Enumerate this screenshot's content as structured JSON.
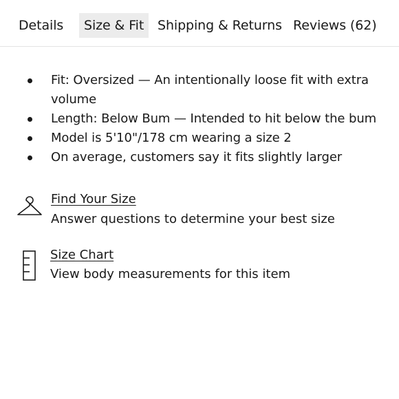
{
  "tabs": [
    {
      "label": "Details",
      "active": false
    },
    {
      "label": "Size & Fit",
      "active": true
    },
    {
      "label": "Shipping & Returns",
      "active": false
    },
    {
      "label": "Reviews (62)",
      "active": false
    }
  ],
  "fit_bullets": [
    "Fit: Oversized — An intentionally loose fit with extra volume",
    "Length: Below Bum — Intended to hit below the bum",
    "Model is 5'10\"/178 cm wearing a size 2",
    "On average, customers say it fits slightly larger"
  ],
  "find_size": {
    "icon": "hanger-icon",
    "link_label": "Find Your Size",
    "description": "Answer questions to determine your best size"
  },
  "size_chart": {
    "icon": "ruler-icon",
    "link_label": "Size Chart",
    "description": "View body measurements for this item"
  }
}
